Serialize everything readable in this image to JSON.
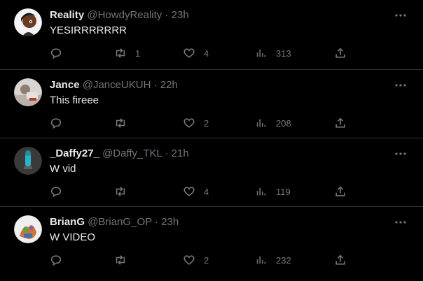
{
  "replies": [
    {
      "name": "Reality",
      "handle": "@HowdyReality",
      "sep": "·",
      "time": "23h",
      "text": "YESIRRRRRRR",
      "reply_count": "",
      "retweet_count": "1",
      "like_count": "4",
      "view_count": "313",
      "avatar_color": "#f4f4f4"
    },
    {
      "name": "Jance",
      "handle": "@JanceUKUH",
      "sep": "·",
      "time": "22h",
      "text": "This fireee",
      "reply_count": "",
      "retweet_count": "",
      "like_count": "2",
      "view_count": "208",
      "avatar_color": "#d9d4cf"
    },
    {
      "name": "_Daffy27_",
      "handle": "@Daffy_TKL",
      "sep": "·",
      "time": "21h",
      "text": "W vid",
      "reply_count": "",
      "retweet_count": "",
      "like_count": "4",
      "view_count": "119",
      "avatar_color": "#3a3a3a"
    },
    {
      "name": "BrianG",
      "handle": "@BrianG_OP",
      "sep": "·",
      "time": "23h",
      "text": "W VIDEO",
      "reply_count": "",
      "retweet_count": "",
      "like_count": "2",
      "view_count": "232",
      "avatar_color": "#efefef"
    }
  ],
  "icons": {
    "more": "more-horizontal-icon",
    "reply": "speech-bubble-icon",
    "retweet": "retweet-arrows-icon",
    "like": "heart-icon",
    "views": "bar-chart-icon",
    "share": "share-upload-icon"
  },
  "colors": {
    "background": "#000000",
    "text": "#e7e9ea",
    "muted": "#71767b",
    "divider": "#2f3336"
  }
}
